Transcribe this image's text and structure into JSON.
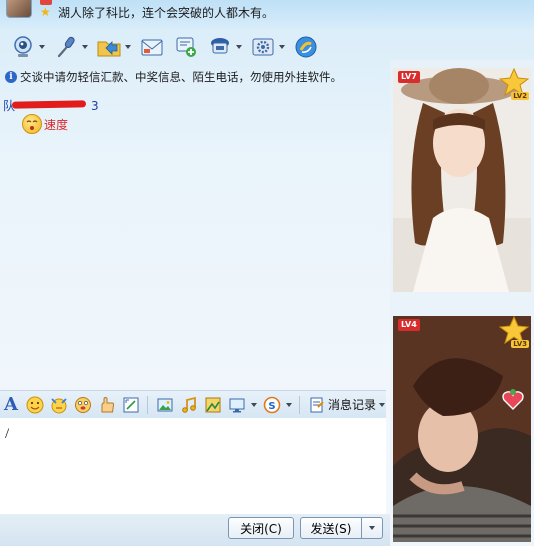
{
  "header": {
    "signature": "湖人除了科比，连个会突破的人都木有。"
  },
  "toolbar": {
    "items": [
      {
        "name": "video-call",
        "icon": "webcam-icon",
        "has_menu": true
      },
      {
        "name": "voice-call",
        "icon": "microphone-icon",
        "has_menu": true
      },
      {
        "name": "send-file",
        "icon": "folder-icon",
        "has_menu": true
      },
      {
        "name": "send-email",
        "icon": "mail-icon",
        "has_menu": false
      },
      {
        "name": "create-group",
        "icon": "chat-add-icon",
        "has_menu": false
      },
      {
        "name": "remote-assist",
        "icon": "remote-icon",
        "has_menu": true
      },
      {
        "name": "app-settings",
        "icon": "gear-icon",
        "has_menu": true
      },
      {
        "name": "qq-apps",
        "icon": "apps-icon",
        "has_menu": false
      }
    ]
  },
  "chat": {
    "notice": "交谈中请勿轻信汇款、中奖信息、陌生电话，勿使用外挂软件。",
    "sender_prefix": "队",
    "sender_suffix": "3",
    "message_text": "速度"
  },
  "input_toolbar": {
    "history_label": "消息记录"
  },
  "input": {
    "text": "/"
  },
  "buttons": {
    "close_label": "关闭(C)",
    "send_label": "发送(S)"
  },
  "profiles": {
    "contact": {
      "level_badge": "LV7",
      "vip_badge": "LV2"
    },
    "self": {
      "level_badge": "LV4",
      "vip_badge": "LV3"
    }
  },
  "colors": {
    "accent": "#2d5cb8",
    "notice_icon": "#2c68c9",
    "message_text": "#d8262a",
    "redaction": "#e21b1b"
  }
}
